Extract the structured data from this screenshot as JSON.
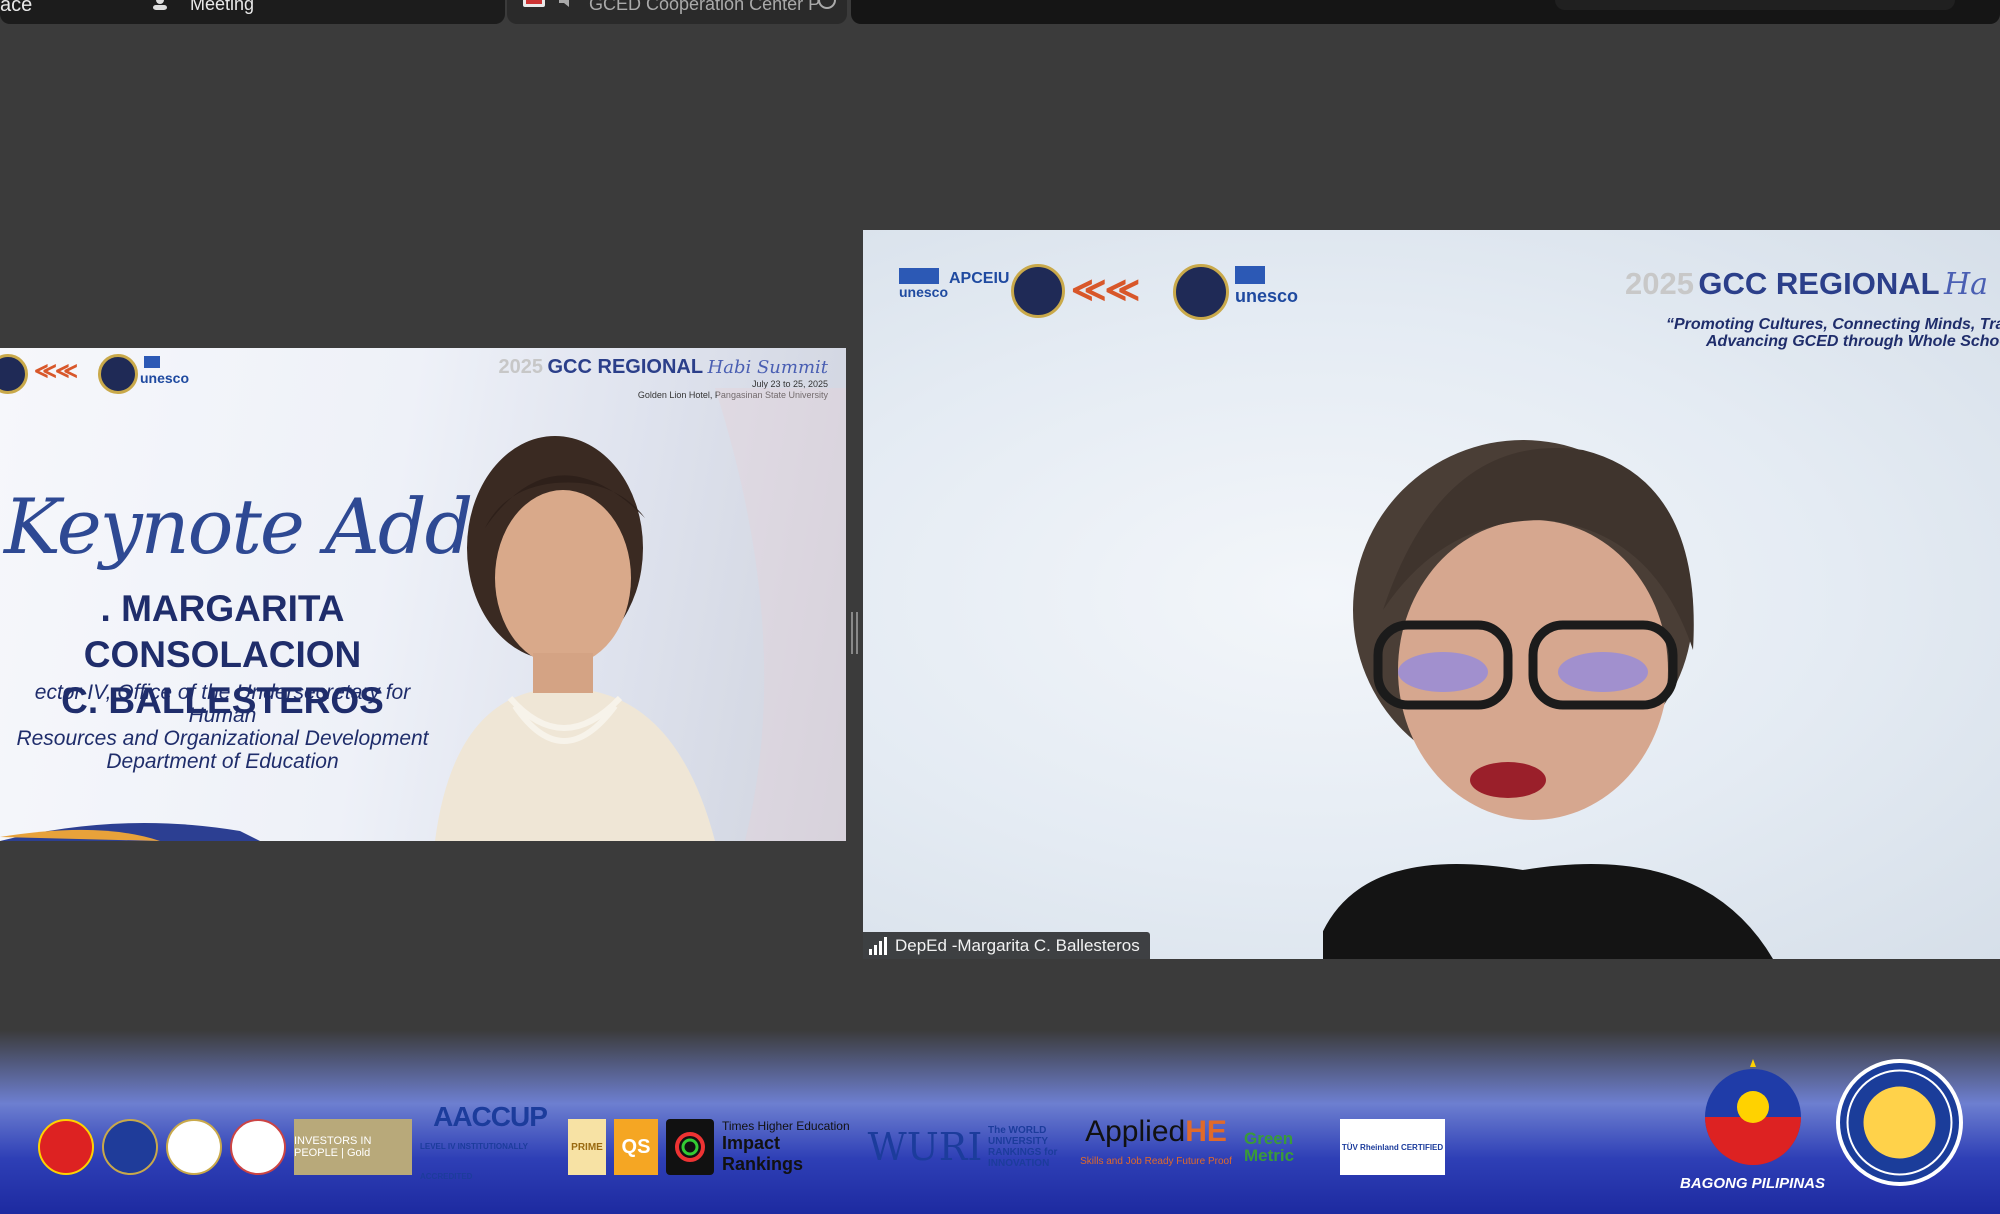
{
  "topbar": {
    "left_text": "ace",
    "meeting_label": "Meeting",
    "center_text": "GCED Cooperation Center P"
  },
  "left_tile": {
    "event_year": "2025",
    "event_title": "GCC REGIONAL",
    "event_script": "Habi Summit",
    "event_dates": "July 23 to 25, 2025",
    "event_venue": "Golden Lion Hotel, Pangasinan State University",
    "logo_text": "unesco",
    "heading": "Keynote Address",
    "speaker_name_line1": ". MARGARITA CONSOLACION",
    "speaker_name_line2": "C. BALLESTEROS",
    "speaker_role_line1": "ector IV, Office of the Undersecretary for Human",
    "speaker_role_line2": "Resources and Organizational Development",
    "speaker_role_line3": "Department of Education"
  },
  "right_tile": {
    "logo_text_1": "unesco",
    "logo_text_2": "APCEIU",
    "logo_text_3": "unesco",
    "event_year": "2025",
    "event_title": "GCC REGIONAL",
    "event_script": "Ha",
    "tagline_line1": "“Promoting Cultures, Connecting Minds, Trans",
    "tagline_line2": "Advancing GCED through Whole School A",
    "participant_name": "DepEd -Margarita C. Ballesteros"
  },
  "banner": {
    "iip": "INVESTORS IN PEOPLE | Gold",
    "aaccup": "AACCUP",
    "aaccup_sub": "LEVEL IV INSTITUTIONALLY ACCREDITED",
    "prime": "PRIME",
    "qs": "QS",
    "the_small": "Times Higher Education",
    "the_large": "Impact Rankings",
    "wuri": "WURI",
    "wurs": "The WORLD UNIVERSITY RANKINGS for INNOVATION",
    "applied_main": "Applied",
    "applied_he": "HE",
    "applied_sub": "Skills and Job Ready  Future Proof",
    "greenmetric": "Green Metric",
    "tuv": "TÜV Rheinland CERTIFIED",
    "bagong_pilipinas": "BAGONG PILIPINAS"
  },
  "colors": {
    "background": "#3b3b3b",
    "slide_navy": "#1f2d6b",
    "banner_blue": "#2e3fb6"
  }
}
